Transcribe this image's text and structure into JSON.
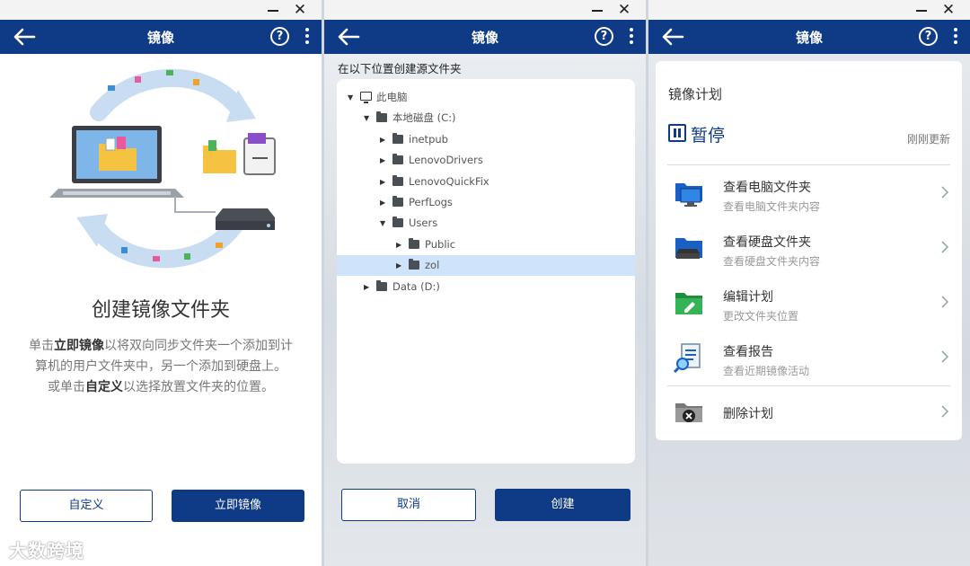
{
  "window_controls": {
    "minimize": "–",
    "close": "✕"
  },
  "panel1": {
    "title": "镜像",
    "help": "?",
    "heading": "创建镜像文件夹",
    "desc": {
      "p1": "单击",
      "b1": "立即镜像",
      "p2": "以将双向同步文件夹一个添加到计算机的用户文件夹中，另一个添加到硬盘上。 或单击",
      "b2": "自定义",
      "p3": "以选择放置文件夹的位置。"
    },
    "btn_custom": "自定义",
    "btn_mirror": "立即镜像"
  },
  "watermark": "大数跨境",
  "panel2": {
    "title": "镜像",
    "help": "?",
    "label": "在以下位置创建源文件夹",
    "tree": [
      {
        "label": "此电脑",
        "depth": 0,
        "arrow": "down",
        "icon": "pc-icon"
      },
      {
        "label": "本地磁盘 (C:)",
        "depth": 1,
        "arrow": "down",
        "icon": "folder-icon"
      },
      {
        "label": "inetpub",
        "depth": 2,
        "arrow": "right",
        "icon": "folder-icon"
      },
      {
        "label": "LenovoDrivers",
        "depth": 2,
        "arrow": "right",
        "icon": "folder-icon"
      },
      {
        "label": "LenovoQuickFix",
        "depth": 2,
        "arrow": "right",
        "icon": "folder-icon"
      },
      {
        "label": "PerfLogs",
        "depth": 2,
        "arrow": "right",
        "icon": "folder-icon"
      },
      {
        "label": "Users",
        "depth": 2,
        "arrow": "down",
        "icon": "folder-icon"
      },
      {
        "label": "Public",
        "depth": 3,
        "arrow": "right",
        "icon": "folder-icon"
      },
      {
        "label": "zol",
        "depth": 3,
        "arrow": "right",
        "icon": "folder-icon",
        "selected": true
      },
      {
        "label": "Data (D:)",
        "depth": 1,
        "arrow": "right",
        "icon": "folder-icon"
      }
    ],
    "btn_cancel": "取消",
    "btn_create": "创建"
  },
  "panel3": {
    "title": "镜像",
    "help": "?",
    "card_title": "镜像计划",
    "status": "暂停",
    "updated": "刚刚更新",
    "items": [
      {
        "title": "查看电脑文件夹",
        "sub": "查看电脑文件夹内容",
        "icon": "pc-folder-icon"
      },
      {
        "title": "查看硬盘文件夹",
        "sub": "查看硬盘文件夹内容",
        "icon": "drive-folder-icon"
      },
      {
        "title": "编辑计划",
        "sub": "更改文件夹位置",
        "icon": "edit-folder-icon"
      },
      {
        "title": "查看报告",
        "sub": "查看近期镜像活动",
        "icon": "report-icon"
      },
      {
        "title": "删除计划",
        "sub": "",
        "icon": "delete-plan-icon"
      }
    ]
  },
  "colors": {
    "brand": "#0f3a85",
    "selection": "#cfe4fb"
  }
}
